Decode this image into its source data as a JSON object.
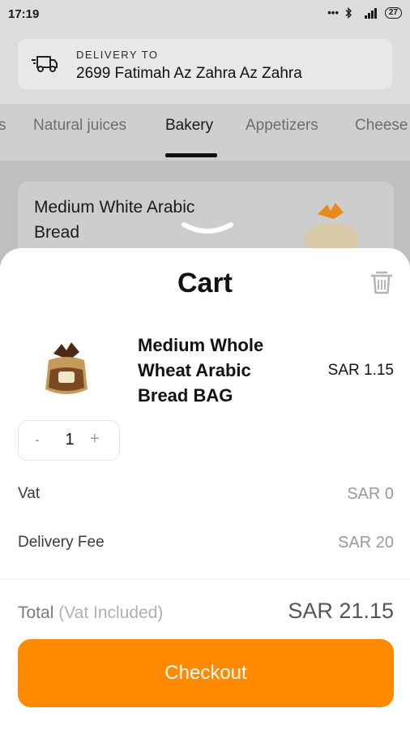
{
  "status_bar": {
    "time": "17:19",
    "icons": [
      "dots-icon",
      "bluetooth-icon",
      "signal-icon"
    ],
    "battery": "27"
  },
  "delivery": {
    "label": "DELIVERY TO",
    "address": "2699 Fatimah Az Zahra Az Zahra",
    "icon": "truck-icon"
  },
  "tabs": [
    {
      "label": "s"
    },
    {
      "label": "Natural juices"
    },
    {
      "label": "Bakery"
    },
    {
      "label": "Appetizers"
    },
    {
      "label": "Cheese"
    }
  ],
  "active_tab": "Bakery",
  "background_product": {
    "title": "Medium White Arabic Bread"
  },
  "cart": {
    "title": "Cart",
    "items": [
      {
        "name": "Medium Whole Wheat Arabic Bread BAG",
        "price": "SAR 1.15",
        "quantity": "1"
      }
    ],
    "stepper": {
      "minus": "-",
      "plus": "+"
    },
    "vat": {
      "label": "Vat",
      "value": "SAR 0"
    },
    "delivery_fee": {
      "label": "Delivery Fee",
      "value": "SAR 20"
    },
    "total": {
      "label": "Total",
      "note": "(Vat Included)",
      "value": "SAR 21.15"
    },
    "checkout_label": "Checkout"
  },
  "colors": {
    "accent": "#ff8a00",
    "overlay": "#bfbfbf",
    "text_primary": "#111111",
    "text_muted": "#9a9a9a"
  }
}
